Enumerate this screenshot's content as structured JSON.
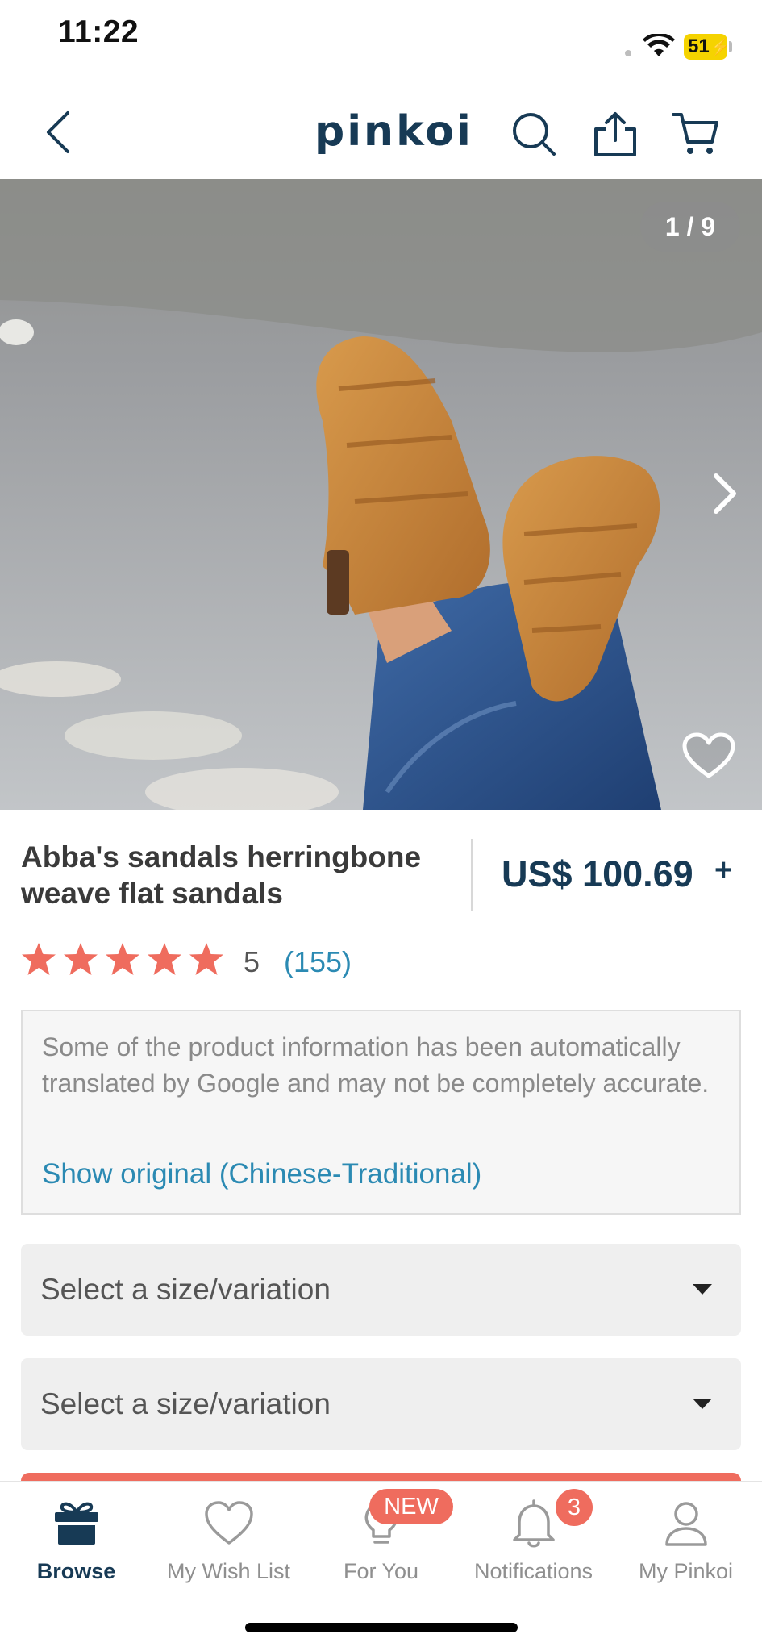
{
  "status_bar": {
    "time": "11:22",
    "battery": "51"
  },
  "header": {
    "logo": "pinkoi",
    "icons": [
      "back-icon",
      "search-icon",
      "share-icon",
      "cart-icon"
    ]
  },
  "gallery": {
    "counter": "1 / 9",
    "icons": [
      "chevron-right-icon",
      "heart-icon"
    ]
  },
  "product": {
    "title": "Abba's sandals herringbone weave flat sandals",
    "price": "US$ 100.69",
    "price_more": "+",
    "rating": {
      "stars": 5,
      "score": "5",
      "count": "(155)"
    }
  },
  "translation_notice": {
    "text": "Some of the product information has been automatically translated by Google and may not be completely accurate.",
    "link": "Show original (Chinese-Traditional)"
  },
  "selectors": [
    {
      "placeholder": "Select a size/variation"
    },
    {
      "placeholder": "Select a size/variation"
    }
  ],
  "tabbar": {
    "tabs": [
      {
        "label": "Browse",
        "icon": "gift-icon",
        "active": true
      },
      {
        "label": "My Wish List",
        "icon": "heart-icon"
      },
      {
        "label": "For You",
        "icon": "lightbulb-icon",
        "badge": "NEW"
      },
      {
        "label": "Notifications",
        "icon": "bell-icon",
        "badge": "3"
      },
      {
        "label": "My Pinkoi",
        "icon": "person-icon"
      }
    ]
  },
  "colors": {
    "brand_navy": "#173a55",
    "accent_coral": "#ef6c5e",
    "link_blue": "#2b8ab3"
  }
}
